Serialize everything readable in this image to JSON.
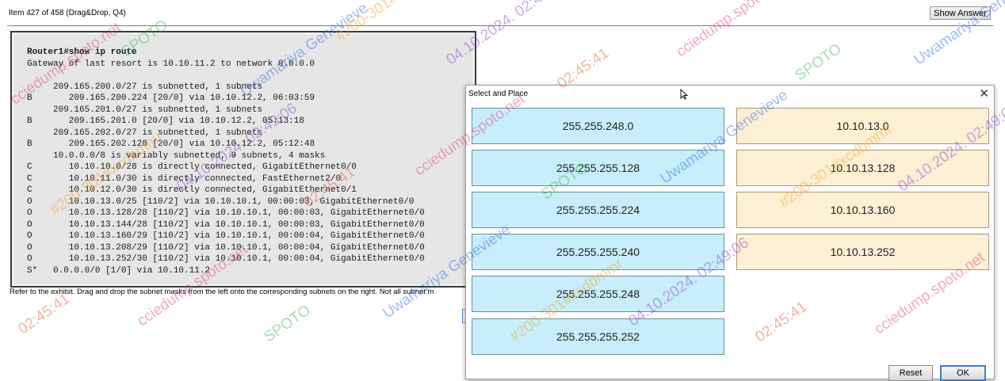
{
  "header": {
    "item_label": "Item 427 of 458  (Drag&Drop, Q4)",
    "show_answer_label": "Show Answer"
  },
  "exhibit": {
    "cli_lines": [
      "Router1#show ip route",
      "Gateway of last resort is 10.10.11.2 to network 0.0.0.0",
      "",
      "     209.165.200.0/27 is subnetted, 1 subnets",
      "B       209.165.200.224 [20/0] via 10.10.12.2, 06:03:59",
      "     209.165.201.0/27 is subnetted, 1 subnets",
      "B       209.165.201.0 [20/0] via 10.10.12.2, 05:13:18",
      "     209.165.202.0/27 is subnetted, 1 subnets",
      "B       209.165.202.128 [20/0] via 10.10.12.2, 05:12:48",
      "     10.0.0.0/8 is variably subnetted, 9 subnets, 4 masks",
      "C       10.10.10.0/28 is directly connected, GigabitEthernet0/0",
      "C       10.10.11.0/30 is directly connected, FastEthernet2/0",
      "C       10.10.12.0/30 is directly connected, GigabitEthernet0/1",
      "O       10.10.13.0/25 [110/2] via 10.10.10.1, 00:00:03, GigabitEthernet0/0",
      "O       10.10.13.128/28 [110/2] via 10.10.10.1, 00:00:03, GigabitEthernet0/0",
      "O       10.10.13.144/28 [110/2] via 10.10.10.1, 00:00:03, GigabitEthernet0/0",
      "O       10.10.13.160/29 [110/2] via 10.10.10.1, 00:00:04, GigabitEthernet0/0",
      "O       10.10.13.208/29 [110/2] via 10.10.10.1, 00:00:04, GigabitEthernet0/0",
      "O       10.10.13.252/30 [110/2] via 10.10.10.1, 00:00:04, GigabitEthernet0/0",
      "S*   0.0.0.0/0 [1/0] via 10.10.11.2"
    ]
  },
  "instructions": "Refer to the exhibit. Drag and drop the subnet masks from the left onto the corresponding subnets on the right. Not all subnet m",
  "dialog": {
    "title": "Select and Place",
    "close_glyph": "✕",
    "masks": [
      "255.255.248.0",
      "255.255.255.128",
      "255.255.255.224",
      "255.255.255.240",
      "255.255.255.248",
      "255.255.255.252"
    ],
    "subnets": [
      "10.10.13.0",
      "10.10.13.128",
      "10.10.13.160",
      "10.10.13.252"
    ],
    "reset_label": "Reset",
    "ok_label": "OK"
  },
  "watermark": {
    "texts": [
      "cciedump.spoto.net",
      "SPOTO",
      "Uwamariya Genevieve",
      "#200-301#xcdbmmr",
      "04.10.2024. 02:49:06",
      "02:45:41"
    ],
    "colors": [
      "#e0407a",
      "#3cb44a",
      "#2a6be0",
      "#f0a020",
      "#8a3fd0",
      "#e05a2a"
    ]
  }
}
